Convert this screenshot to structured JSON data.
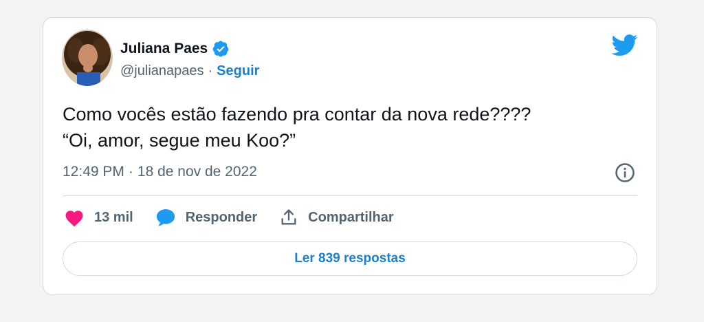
{
  "tweet": {
    "author": {
      "name": "Juliana Paes",
      "handle": "@julianapaes",
      "separator": "·",
      "follow_label": "Seguir"
    },
    "text_lines": [
      "Como vocês estão fazendo pra contar da nova rede????",
      "“Oi, amor, segue meu Koo?”"
    ],
    "time": "12:49 PM",
    "meta_separator": "·",
    "date": "18 de nov de 2022",
    "actions": {
      "likes": "13 mil",
      "reply_label": "Responder",
      "share_label": "Compartilhar"
    },
    "read_replies_label": "Ler 839 respostas"
  },
  "colors": {
    "accent": "#1d9bf0",
    "like": "#f91880",
    "text": "#0f1419",
    "muted": "#536471",
    "border": "#cfd9de"
  },
  "icons": [
    "avatar",
    "verified-badge-icon",
    "twitter-bird-icon",
    "info-icon",
    "heart-icon",
    "reply-bubble-icon",
    "share-icon"
  ]
}
